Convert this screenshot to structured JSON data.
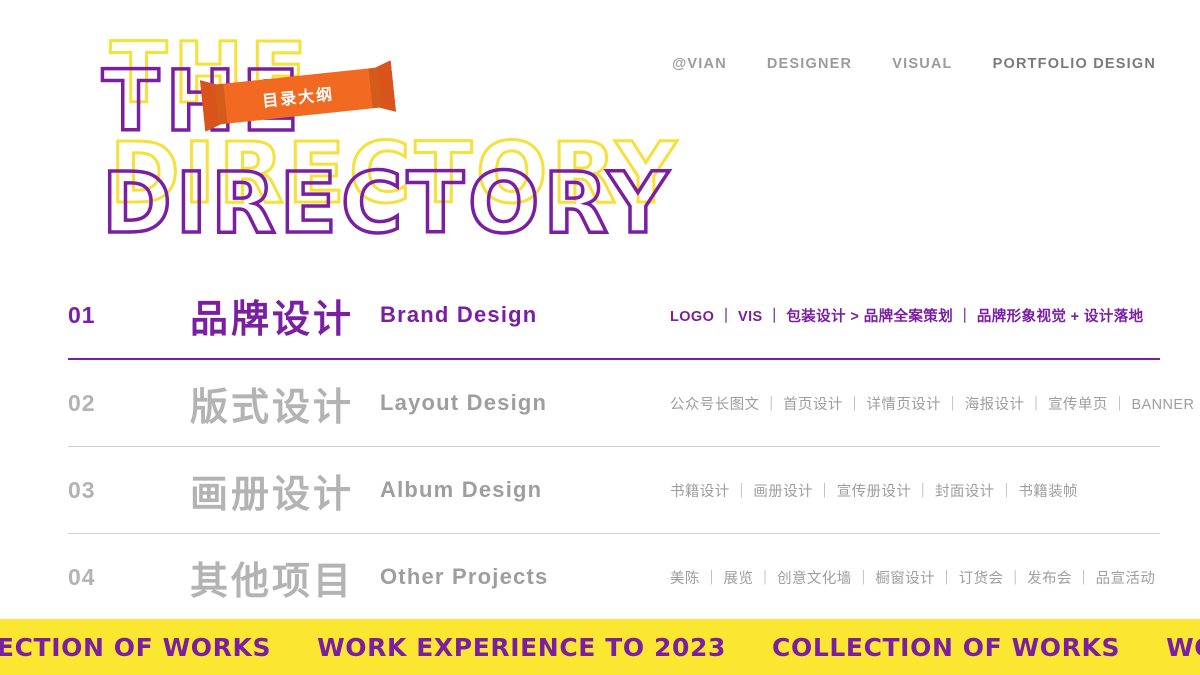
{
  "nav": {
    "items": [
      {
        "label": "@VIAN"
      },
      {
        "label": "DESIGNER"
      },
      {
        "label": "VISUAL"
      },
      {
        "label": "PORTFOLIO DESIGN"
      }
    ]
  },
  "title": {
    "line1": "THE",
    "line2": "DIRECTORY",
    "outline_yellow": "#f5e03c",
    "outline_purple": "#7b1fa2"
  },
  "ribbon": {
    "label": "目录大纲",
    "color": "#f26a21",
    "fold_color": "#d9541a",
    "text_color": "#ffffff"
  },
  "toc": {
    "rows": [
      {
        "num": "01",
        "cn": "品牌设计",
        "en": "Brand Design",
        "detail": "LOGO ｜ VIS ｜ 包装设计 > 品牌全案策划 ｜ 品牌形象视觉 + 设计落地",
        "active": true
      },
      {
        "num": "02",
        "cn": "版式设计",
        "en": "Layout Design",
        "detail": "公众号长图文 ｜ 首页设计 ｜ 详情页设计 ｜ 海报设计 ｜ 宣传单页 ｜ BANNER",
        "active": false
      },
      {
        "num": "03",
        "cn": "画册设计",
        "en": "Album Design",
        "detail": "书籍设计 ｜ 画册设计 ｜ 宣传册设计 ｜ 封面设计 ｜ 书籍装帧",
        "active": false
      },
      {
        "num": "04",
        "cn": "其他项目",
        "en": "Other Projects",
        "detail": "美陈 ｜ 展览 ｜ 创意文化墙 ｜ 橱窗设计 ｜ 订货会 ｜ 发布会 ｜ 品宣活动",
        "active": false
      }
    ],
    "active_color": "#7b1fa2",
    "inactive_color": "#b3b3b3"
  },
  "footer": {
    "background": "#fbe731",
    "text_color": "#7b1fa2",
    "items": [
      "OLLECTION OF WORKS",
      "WORK EXPERIENCE TO 2023",
      "COLLECTION OF WORKS",
      "WORK EXPERIE"
    ]
  }
}
